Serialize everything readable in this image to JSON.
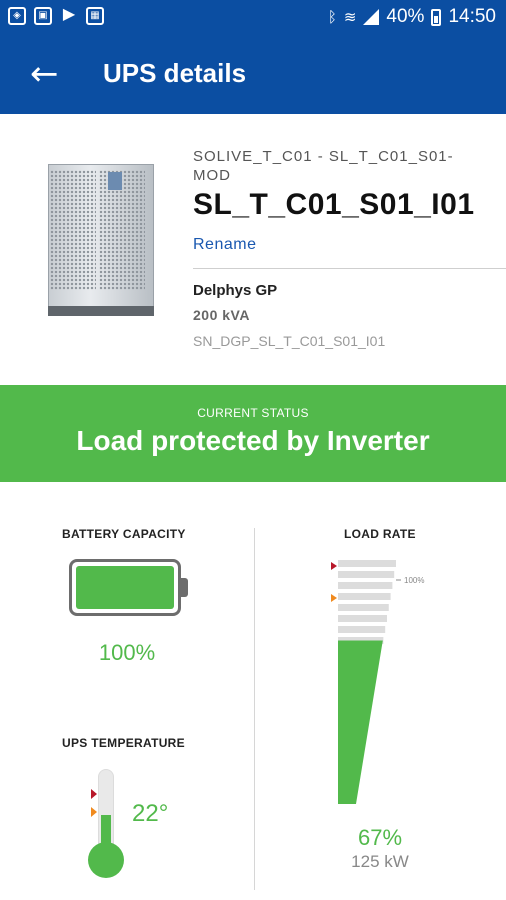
{
  "status_bar": {
    "left_icons": [
      "shield-notification-icon",
      "screenshot-icon",
      "play-store-icon",
      "calendar-icon"
    ],
    "battery_percent": "40%",
    "time": "14:50"
  },
  "app_bar": {
    "title": "UPS details",
    "back_icon": "arrow-left-icon"
  },
  "device": {
    "subtitle": "SOLIVE_T_C01 - SL_T_C01_S01-MOD",
    "name": "SL_T_C01_S01_I01",
    "rename_label": "Rename",
    "model": "Delphys GP",
    "power": "200 kVA",
    "serial": "SN_DGP_SL_T_C01_S01_I01"
  },
  "current_status": {
    "label": "CURRENT STATUS",
    "value": "Load protected by Inverter",
    "color": "#52b94b"
  },
  "battery": {
    "title": "BATTERY CAPACITY",
    "value_text": "100%",
    "level": 1.0
  },
  "temperature": {
    "title": "UPS TEMPERATURE",
    "value_text": "22°",
    "level": 0.3
  },
  "load_rate": {
    "title": "LOAD RATE",
    "value_text": "67%",
    "power_text": "125 kW",
    "marker_label": "100%",
    "level": 0.67
  },
  "colors": {
    "brand": "#0b4ea2",
    "ok": "#52b94b",
    "alarm": "#b8182a",
    "warning": "#f08a1e"
  }
}
